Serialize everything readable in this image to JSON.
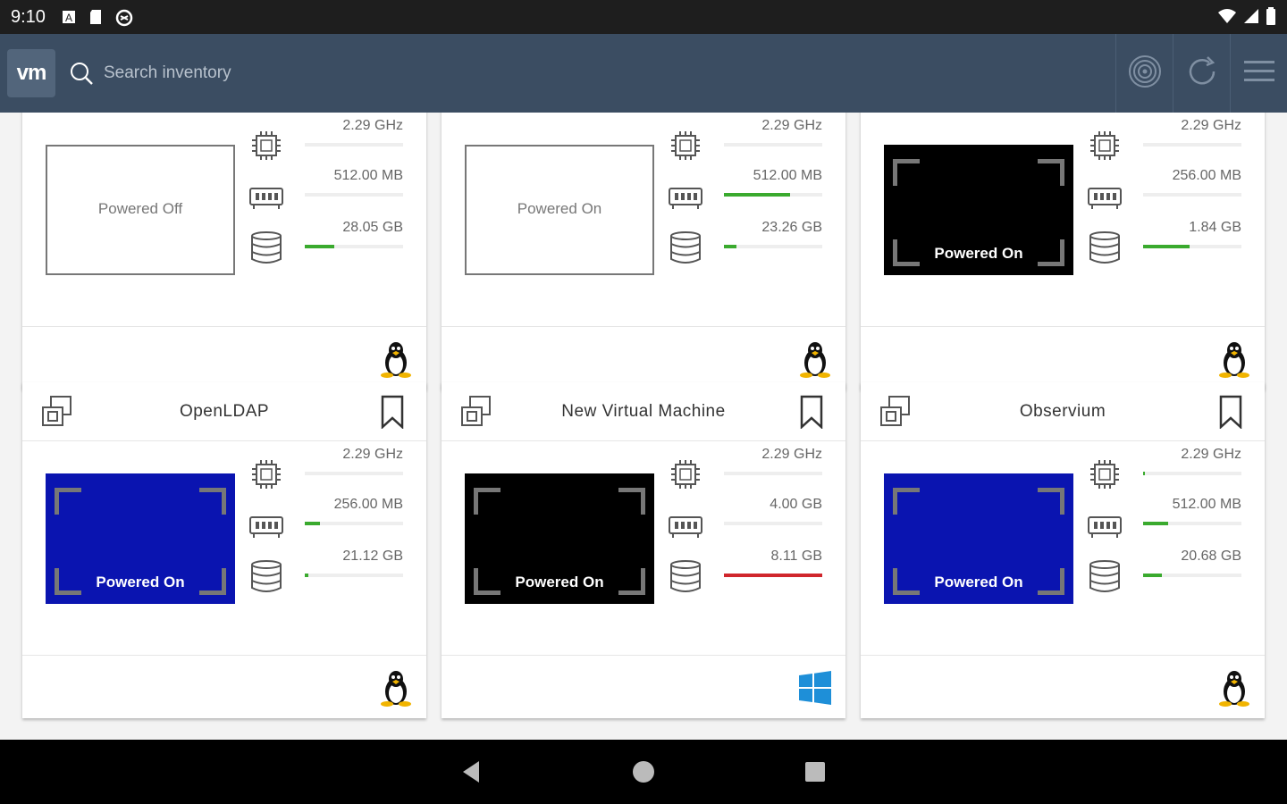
{
  "status_bar": {
    "time": "9:10"
  },
  "header": {
    "logo": "vm",
    "search_placeholder": "Search inventory",
    "actions": [
      "radar-icon",
      "refresh-icon",
      "menu-icon"
    ]
  },
  "cards": [
    {
      "name": "",
      "state": "Powered Off",
      "thumb_style": "off",
      "os": "linux",
      "cpu": "2.29 GHz",
      "cpu_pct": 0,
      "mem": "512.00 MB",
      "mem_pct": 0,
      "disk": "28.05 GB",
      "disk_pct": 0.3,
      "disk_color": "green"
    },
    {
      "name": "",
      "state": "Powered On",
      "thumb_style": "off",
      "os": "linux",
      "cpu": "2.29 GHz",
      "cpu_pct": 0,
      "mem": "512.00 MB",
      "mem_pct": 0.67,
      "disk": "23.26 GB",
      "disk_pct": 0.13,
      "disk_color": "green"
    },
    {
      "name": "",
      "state": "Powered On",
      "thumb_style": "black",
      "os": "linux",
      "cpu": "2.29 GHz",
      "cpu_pct": 0,
      "mem": "256.00 MB",
      "mem_pct": 0,
      "disk": "1.84 GB",
      "disk_pct": 0.47,
      "disk_color": "green"
    },
    {
      "name": "OpenLDAP",
      "state": "Powered On",
      "thumb_style": "blue",
      "os": "linux",
      "cpu": "2.29 GHz",
      "cpu_pct": 0,
      "mem": "256.00 MB",
      "mem_pct": 0.15,
      "disk": "21.12 GB",
      "disk_pct": 0.04,
      "disk_color": "green"
    },
    {
      "name": "New Virtual Machine",
      "state": "Powered On",
      "thumb_style": "black",
      "os": "windows",
      "cpu": "2.29 GHz",
      "cpu_pct": 0,
      "mem": "4.00 GB",
      "mem_pct": 0,
      "disk": "8.11 GB",
      "disk_pct": 1.0,
      "disk_color": "red"
    },
    {
      "name": "Observium",
      "state": "Powered On",
      "thumb_style": "blue",
      "os": "linux",
      "cpu": "2.29 GHz",
      "cpu_pct": 0.02,
      "mem": "512.00 MB",
      "mem_pct": 0.25,
      "disk": "20.68 GB",
      "disk_pct": 0.19,
      "disk_color": "green"
    }
  ],
  "colors": {
    "header_bg": "#3b4d62",
    "green": "#3aaa2e",
    "red": "#d0262c",
    "thumb_blue": "#0a14b0"
  }
}
